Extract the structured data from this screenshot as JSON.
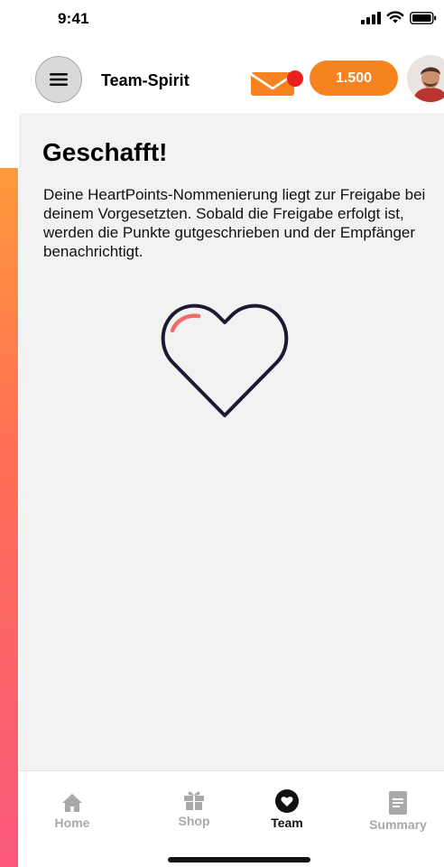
{
  "status_bar": {
    "time": "9:41",
    "icons": [
      "signal-icon",
      "wifi-icon",
      "battery-icon"
    ]
  },
  "header": {
    "menu_icon": "hamburger-icon",
    "title": "Team-Spirit",
    "mail_icon": "mail-icon",
    "has_notification": true,
    "points": "1.500"
  },
  "content": {
    "title": "Geschafft!",
    "message": "Deine HeartPoints-Nommenierung liegt zur Freigabe bei deinem Vorgesetzten. Sobald die Freigabe erfolgt ist, werden die Punkte gutgeschrieben und der Empfänger benachrichtigt.",
    "illustration": "heart-icon"
  },
  "nav": {
    "items": [
      {
        "label": "Home",
        "icon": "home-icon",
        "active": false
      },
      {
        "label": "Shop",
        "icon": "gift-icon",
        "active": false
      },
      {
        "label": "Team",
        "icon": "heart-circle-icon",
        "active": true
      },
      {
        "label": "Summary",
        "icon": "document-icon",
        "active": false
      }
    ]
  },
  "colors": {
    "accent": "#f6831f",
    "notification": "#e8201f",
    "heart_stroke": "#1a1a33",
    "heart_shine": "#f26b6b",
    "gradient_top": "#ff9a3c",
    "gradient_bottom": "#f9587b"
  }
}
